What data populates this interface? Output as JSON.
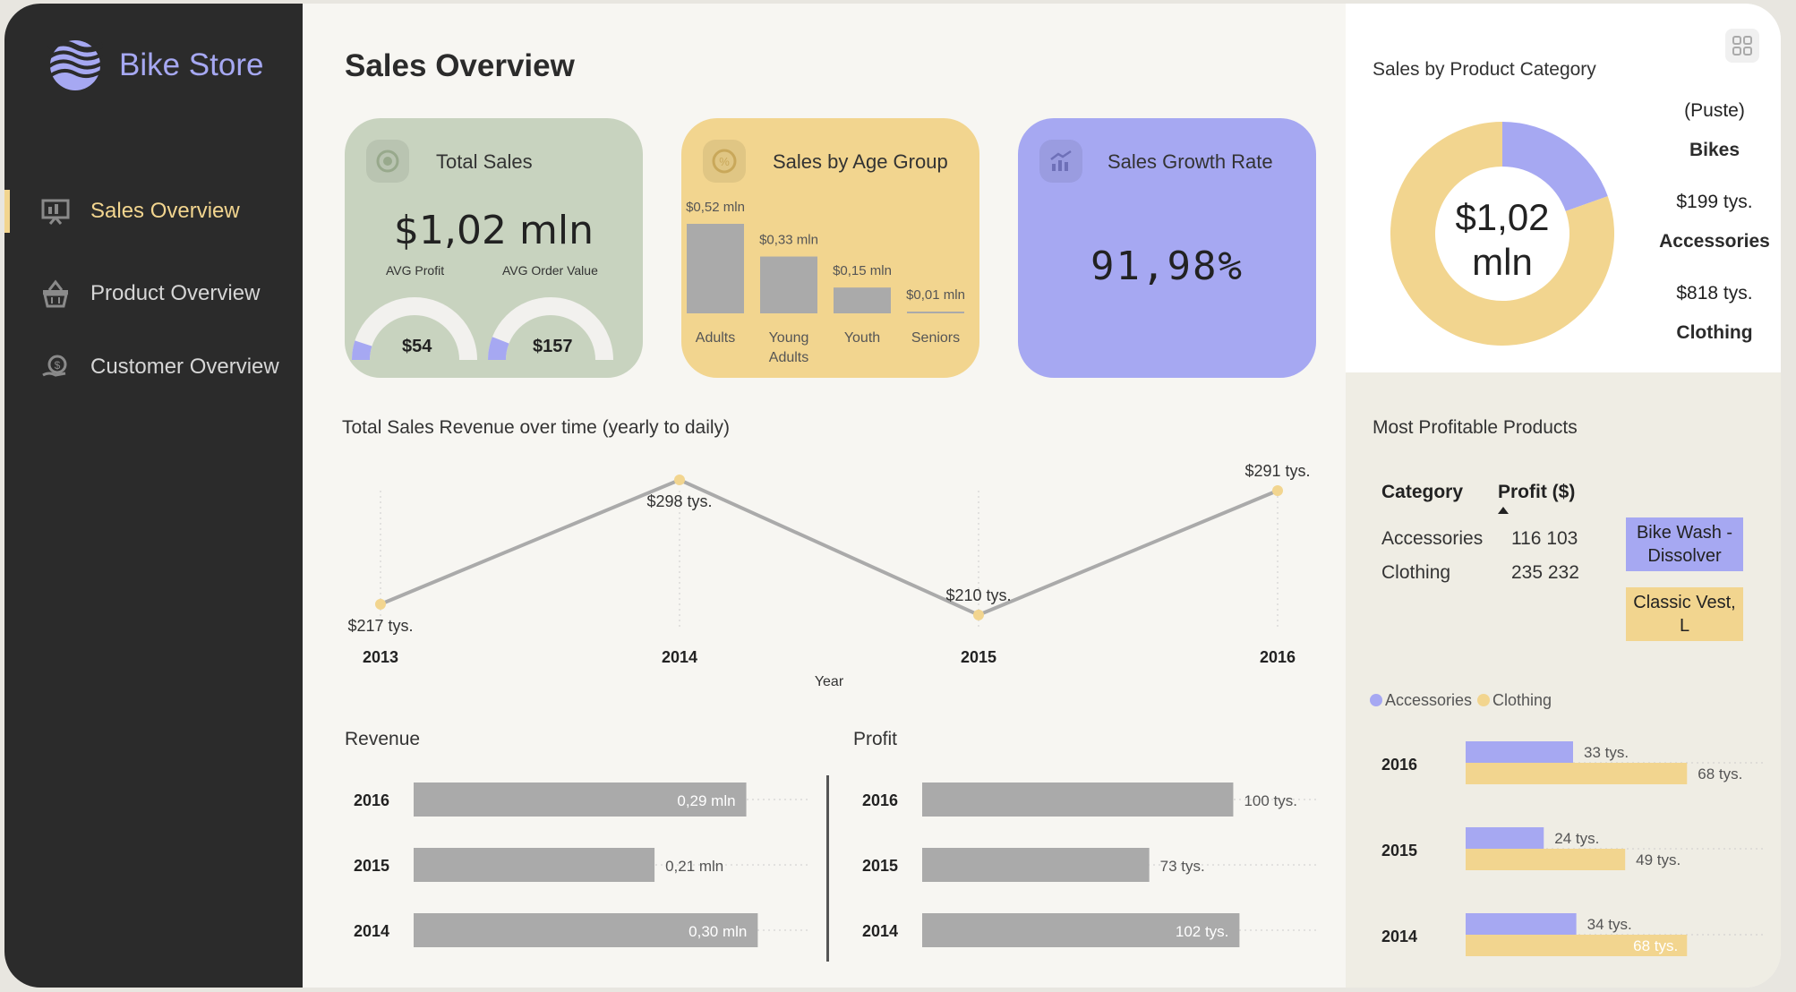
{
  "app": {
    "name": "Bike Store"
  },
  "nav": [
    {
      "label": "Sales Overview",
      "active": true,
      "icon": "presentation-chart-icon"
    },
    {
      "label": "Product Overview",
      "active": false,
      "icon": "basket-icon"
    },
    {
      "label": "Customer Overview",
      "active": false,
      "icon": "customer-money-icon"
    }
  ],
  "page_title": "Sales Overview",
  "colors": {
    "sidebar": "#2b2b2b",
    "accent_yellow": "#f2d58f",
    "accent_purple": "#a6a8f2",
    "accent_green": "#c8d3bf",
    "bar_gray": "#aaaaaa"
  },
  "cards": {
    "total_sales": {
      "title": "Total Sales",
      "value": "$1,02 mln",
      "avg_profit_label": "AVG Profit",
      "avg_order_label": "AVG Order Value",
      "avg_profit_value": "$54",
      "avg_order_value": "$157",
      "avg_profit_fill": 0.1,
      "avg_order_fill": 0.12
    },
    "age_group": {
      "title": "Sales by Age Group",
      "values": [
        "$0,52 mln",
        "$0,33 mln",
        "$0,15 mln",
        "$0,01 mln"
      ],
      "categories": [
        "Adults",
        "Young Adults",
        "Youth",
        "Seniors"
      ]
    },
    "growth": {
      "title": "Sales Growth Rate",
      "value": "91,98%"
    }
  },
  "revenue_over_time": {
    "title": "Total Sales Revenue over time (yearly to daily)",
    "xlabel": "Year"
  },
  "revenue": {
    "title": "Revenue"
  },
  "profit": {
    "title": "Profit"
  },
  "category_donut": {
    "title": "Sales by Product Category",
    "center": [
      "$1,02",
      "mln"
    ],
    "labels": [
      {
        "value": "(Puste)",
        "name": "Bikes",
        "color": "#c8d3bf"
      },
      {
        "value": "$199 tys.",
        "name": "Accessories",
        "color": "#a6a8f2"
      },
      {
        "value": "$818 tys.",
        "name": "Clothing",
        "color": "#f2d58f"
      }
    ]
  },
  "profitable": {
    "title": "Most Profitable Products",
    "col_category": "Category",
    "col_profit": "Profit ($)",
    "rows": [
      {
        "category": "Accessories",
        "profit": "116 103"
      },
      {
        "category": "Clothing",
        "profit": "235 232"
      }
    ],
    "products": [
      "Bike Wash - Dissolver",
      "Classic Vest, L"
    ]
  },
  "chart_data": [
    {
      "type": "line",
      "title": "Total Sales Revenue over time (yearly to daily)",
      "xlabel": "Year",
      "x": [
        "2013",
        "2014",
        "2015",
        "2016"
      ],
      "values": [
        217,
        298,
        210,
        291
      ],
      "labels": [
        "$217 tys.",
        "$298 tys.",
        "$210 tys.",
        "$291 tys."
      ]
    },
    {
      "type": "bar",
      "title": "Revenue",
      "categories": [
        "2016",
        "2015",
        "2014"
      ],
      "values": [
        0.29,
        0.21,
        0.3
      ],
      "labels": [
        "0,29 mln",
        "0,21 mln",
        "0,30 mln"
      ],
      "xlim": [
        0,
        0.32
      ]
    },
    {
      "type": "bar",
      "title": "Profit",
      "categories": [
        "2016",
        "2015",
        "2014"
      ],
      "values": [
        100,
        73,
        102
      ],
      "labels": [
        "100 tys.",
        "73 tys.",
        "102 tys."
      ],
      "xlim": [
        0,
        118
      ]
    },
    {
      "type": "bar",
      "title": "Sales by Age Group",
      "categories": [
        "Adults",
        "Young Adults",
        "Youth",
        "Seniors"
      ],
      "values": [
        0.52,
        0.33,
        0.15,
        0.01
      ]
    },
    {
      "type": "pie",
      "title": "Sales by Product Category",
      "categories": [
        "Accessories",
        "Clothing"
      ],
      "values": [
        199,
        818
      ]
    },
    {
      "type": "bar",
      "title": "",
      "categories": [
        "2016",
        "2015",
        "2014"
      ],
      "legend": "top-left",
      "series": [
        {
          "name": "Accessories",
          "color": "#a6a8f2",
          "values": [
            33,
            24,
            34
          ],
          "labels": [
            "33 tys.",
            "24 tys.",
            "34 tys."
          ]
        },
        {
          "name": "Clothing",
          "color": "#f2d58f",
          "values": [
            68,
            49,
            68
          ],
          "labels": [
            "68 tys.",
            "49 tys.",
            "68 tys."
          ]
        }
      ],
      "xlim": [
        0,
        88
      ]
    }
  ]
}
